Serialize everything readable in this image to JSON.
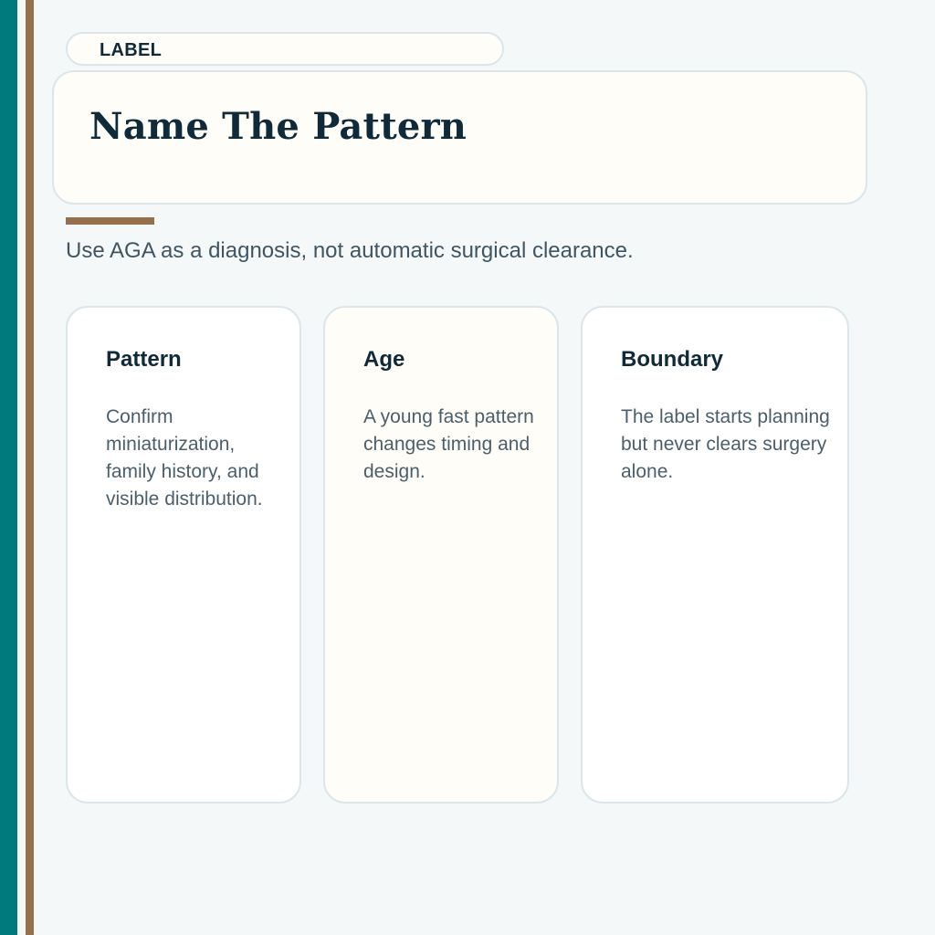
{
  "header": {
    "label": "LABEL",
    "title": "Name The Pattern"
  },
  "subtitle": "Use AGA as a diagnosis, not automatic surgical clearance.",
  "cards": [
    {
      "heading": "Pattern",
      "body": "Confirm miniaturization, family history, and visible distribution."
    },
    {
      "heading": "Age",
      "body": "A young fast pattern changes timing and design."
    },
    {
      "heading": "Boundary",
      "body": "The label starts planning but never clears surgery alone."
    }
  ],
  "colors": {
    "teal": "#007a7d",
    "bronze": "#94714a",
    "ink": "#0f2a3a",
    "muted": "#4a5f6c",
    "cream": "#fffdf7",
    "border": "#dce6ea"
  }
}
